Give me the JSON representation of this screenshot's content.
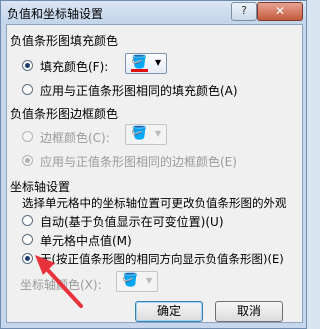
{
  "window": {
    "title": "负值和坐标轴设置",
    "help_label": "?",
    "close_label": "✕"
  },
  "fill": {
    "section_title": "负值条形图填充颜色",
    "option_fill_color": "填充颜色(F):",
    "option_same_as_positive": "应用与正值条形图相同的填充颜色(A)"
  },
  "border": {
    "section_title": "负值条形图边框颜色",
    "option_border_color": "边框颜色(C):",
    "option_same_as_positive": "应用与正值条形图相同的边框颜色(E)"
  },
  "axis": {
    "section_title": "坐标轴设置",
    "description": "选择单元格中的坐标轴位置可更改负值条形图的外观",
    "option_auto": "自动(基于负值显示在可变位置)(U)",
    "option_midpoint": "单元格中点值(M)",
    "option_none": "无(按正值条形图的相同方向显示负值条形图)(E)",
    "axis_color_label": "坐标轴颜色(X):"
  },
  "buttons": {
    "ok": "确定",
    "cancel": "取消"
  },
  "colors": {
    "fill_swatch": "#e01010",
    "annotation_arrow": "#e8323c"
  },
  "icons": {
    "paint_bucket": "paint-bucket-icon",
    "dropdown": "chevron-down-icon"
  }
}
